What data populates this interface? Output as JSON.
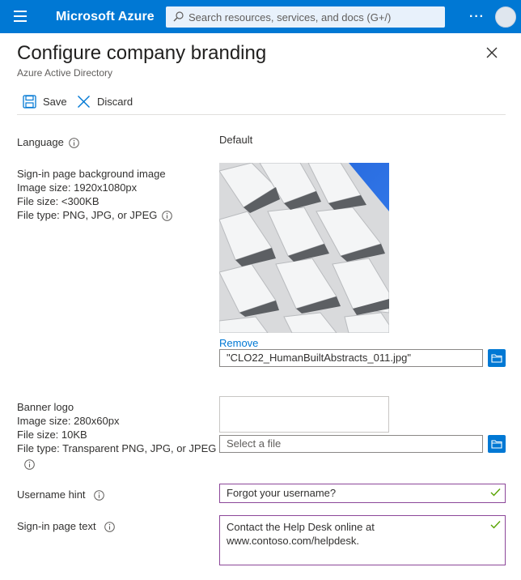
{
  "header": {
    "brand": "Microsoft Azure",
    "search_placeholder": "Search resources, services, and docs (G+/)",
    "more": "···"
  },
  "blade": {
    "title": "Configure company branding",
    "subtitle": "Azure Active Directory"
  },
  "toolbar": {
    "save_label": "Save",
    "discard_label": "Discard"
  },
  "form": {
    "language": {
      "label": "Language",
      "value": "Default"
    },
    "background": {
      "label": "Sign-in page background image",
      "size": "Image size: 1920x1080px",
      "file_size": "File size: <300KB",
      "file_type": "File type: PNG, JPG, or JPEG",
      "remove_label": "Remove",
      "filename": "\"CLO22_HumanBuiltAbstracts_011.jpg\""
    },
    "banner": {
      "label": "Banner logo",
      "size": "Image size: 280x60px",
      "file_size": "File size: 10KB",
      "file_type": "File type: Transparent PNG, JPG, or JPEG",
      "placeholder": "Select a file"
    },
    "username_hint": {
      "label": "Username hint",
      "value": "Forgot your username?"
    },
    "signin_text": {
      "label": "Sign-in page text",
      "line1": "Contact the Help Desk online at",
      "line2": "www.contoso.com/helpdesk."
    }
  },
  "colors": {
    "accent": "#0078d4",
    "valid_border": "#8c4799",
    "valid_check": "#57a300"
  }
}
